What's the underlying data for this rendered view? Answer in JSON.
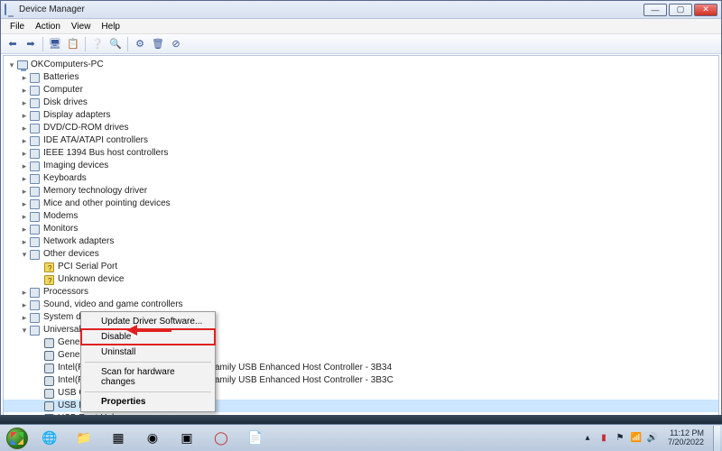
{
  "window": {
    "title": "Device Manager",
    "menus": [
      "File",
      "Action",
      "View",
      "Help"
    ]
  },
  "tree": {
    "root": "OKComputers-PC",
    "categories": [
      "Batteries",
      "Computer",
      "Disk drives",
      "Display adapters",
      "DVD/CD-ROM drives",
      "IDE ATA/ATAPI controllers",
      "IEEE 1394 Bus host controllers",
      "Imaging devices",
      "Keyboards",
      "Memory technology driver",
      "Mice and other pointing devices",
      "Modems",
      "Monitors",
      "Network adapters"
    ],
    "other_devices": {
      "label": "Other devices",
      "children": [
        "PCI Serial Port",
        "Unknown device"
      ]
    },
    "categories2": [
      "Processors",
      "Sound, video and game controllers",
      "System devices"
    ],
    "usb": {
      "label": "Universal Serial Bus controllers",
      "children": [
        "Generic USB Hub",
        "Generic USB Hub",
        "Intel(R) 5 Series/3400 Series Chipset Family USB Enhanced Host Controller - 3B34",
        "Intel(R) 5 Series/3400 Series Chipset Family USB Enhanced Host Controller - 3B3C",
        "USB Composite Device",
        "USB Root Hub",
        "USB Root Hub"
      ],
      "selected_index": 5
    }
  },
  "context_menu": {
    "items": [
      "Update Driver Software...",
      "Disable",
      "Uninstall",
      "Scan for hardware changes",
      "Properties"
    ],
    "highlighted_index": 1,
    "bold_index": 4,
    "separators_after": [
      2,
      3
    ]
  },
  "taskbar": {
    "clock_time": "11:12 PM",
    "clock_date": "7/20/2022"
  }
}
